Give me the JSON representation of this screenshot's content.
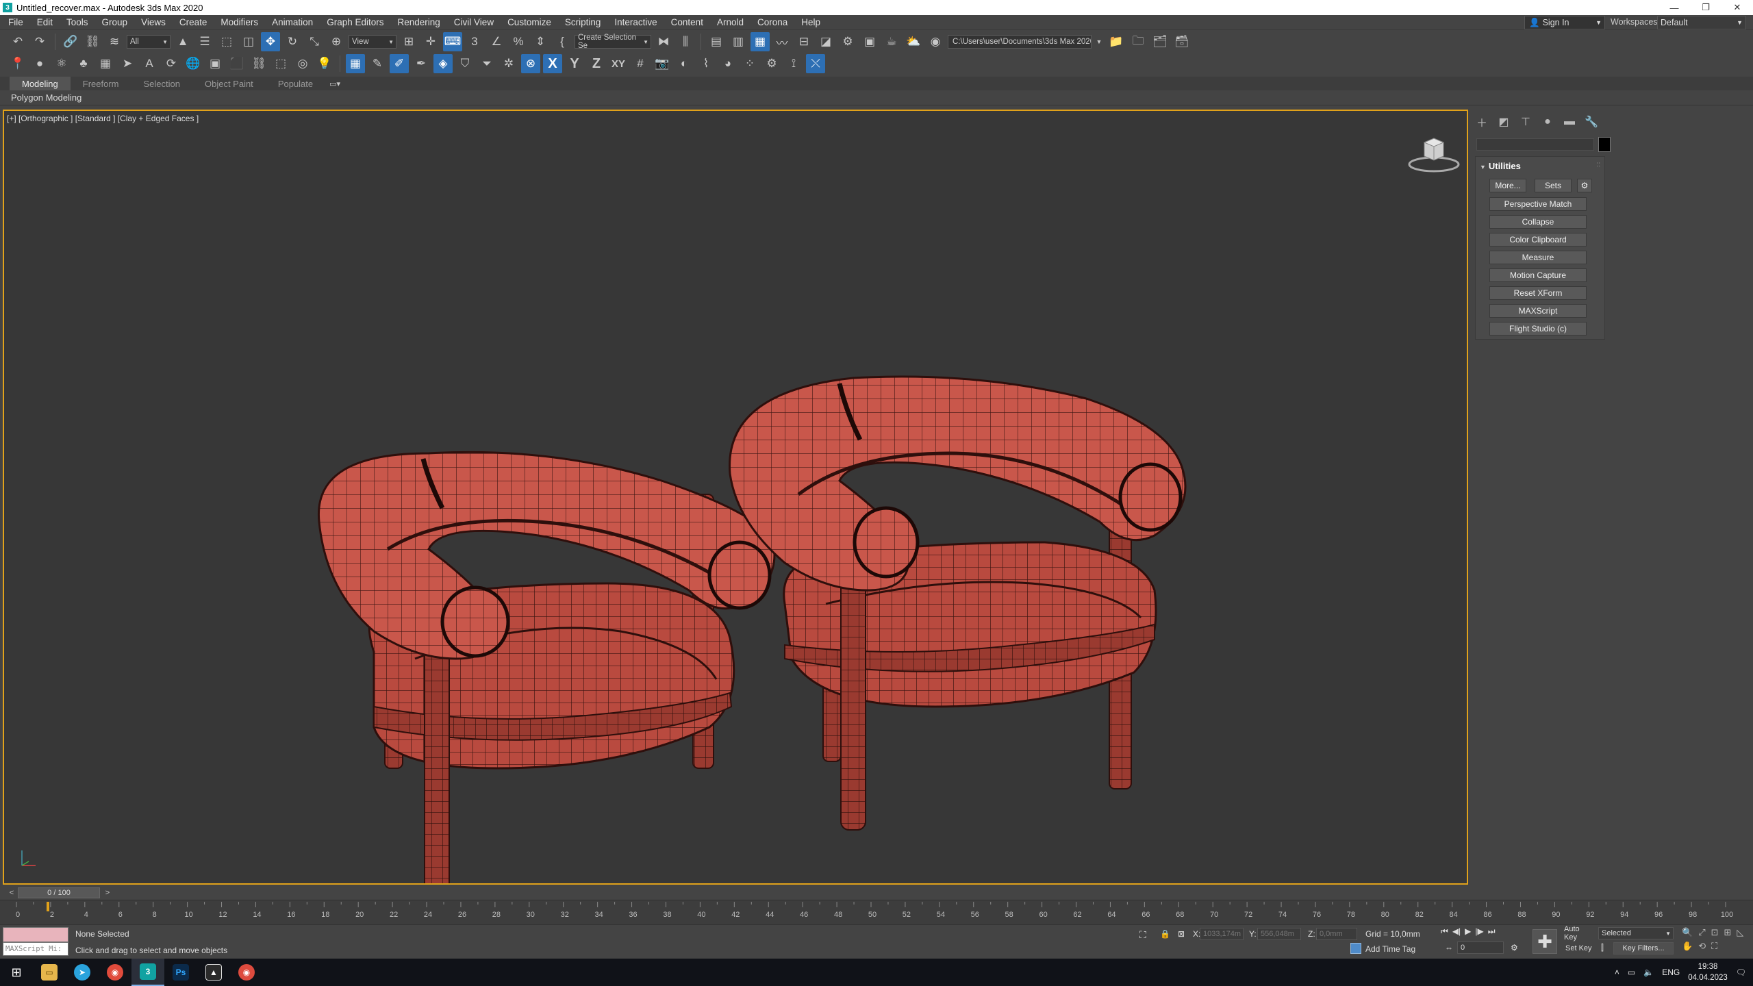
{
  "window": {
    "title": "Untitled_recover.max - Autodesk 3ds Max 2020",
    "controls": [
      "—",
      "❐",
      "✕"
    ]
  },
  "menu": [
    "File",
    "Edit",
    "Tools",
    "Group",
    "Views",
    "Create",
    "Modifiers",
    "Animation",
    "Graph Editors",
    "Rendering",
    "Civil View",
    "Customize",
    "Scripting",
    "Interactive",
    "Content",
    "Arnold",
    "Corona",
    "Help"
  ],
  "account": {
    "sign_in": "Sign In",
    "workspaces_label": "Workspaces:",
    "workspace": "Default"
  },
  "toolbar": {
    "filter": "All",
    "coord_system": "View",
    "selection_set": "Create Selection Se",
    "project_path": "C:\\Users\\user\\Documents\\3ds Max 2020",
    "axis_x": "X",
    "axis_y": "Y",
    "axis_z": "Z",
    "axis_xy": "XY"
  },
  "ribbon": {
    "tabs": [
      "Modeling",
      "Freeform",
      "Selection",
      "Object Paint",
      "Populate"
    ],
    "active_tab": "Modeling",
    "panel_label": "Polygon Modeling"
  },
  "viewport": {
    "label": "[+] [Orthographic ] [Standard ] [Clay + Edged Faces ]",
    "object_color": "#b5433a",
    "active_border": "#e1a21a"
  },
  "command_panel": {
    "rollout_title": "Utilities",
    "more_button": "More...",
    "sets_button": "Sets",
    "utilities": [
      "Perspective Match",
      "Collapse",
      "Color Clipboard",
      "Measure",
      "Motion Capture",
      "Reset XForm",
      "MAXScript",
      "Flight Studio (c)"
    ]
  },
  "timeline": {
    "frame_display": "0 / 100",
    "ticks": [
      0,
      2,
      4,
      6,
      8,
      10,
      12,
      14,
      16,
      18,
      20,
      22,
      24,
      26,
      28,
      30,
      32,
      34,
      36,
      38,
      40,
      42,
      44,
      46,
      48,
      50,
      52,
      54,
      56,
      58,
      60,
      62,
      64,
      66,
      68,
      70,
      72,
      74,
      76,
      78,
      80,
      82,
      84,
      86,
      88,
      90,
      92,
      94,
      96,
      98,
      100
    ]
  },
  "status": {
    "maxscript_label": "MAXScript Mi:",
    "selection": "None Selected",
    "prompt": "Click and drag to select and move objects",
    "x_label": "X:",
    "x_value": "1033,174m",
    "y_label": "Y:",
    "y_value": "556,048m",
    "z_label": "Z:",
    "z_value": "0,0mm",
    "grid": "Grid = 10,0mm",
    "add_time_tag": "Add Time Tag",
    "current_frame": "0",
    "auto_key": "Auto Key",
    "selected": "Selected",
    "set_key": "Set Key",
    "key_filters": "Key Filters..."
  },
  "taskbar": {
    "language": "ENG",
    "time": "19:38",
    "date": "04.04.2023"
  }
}
